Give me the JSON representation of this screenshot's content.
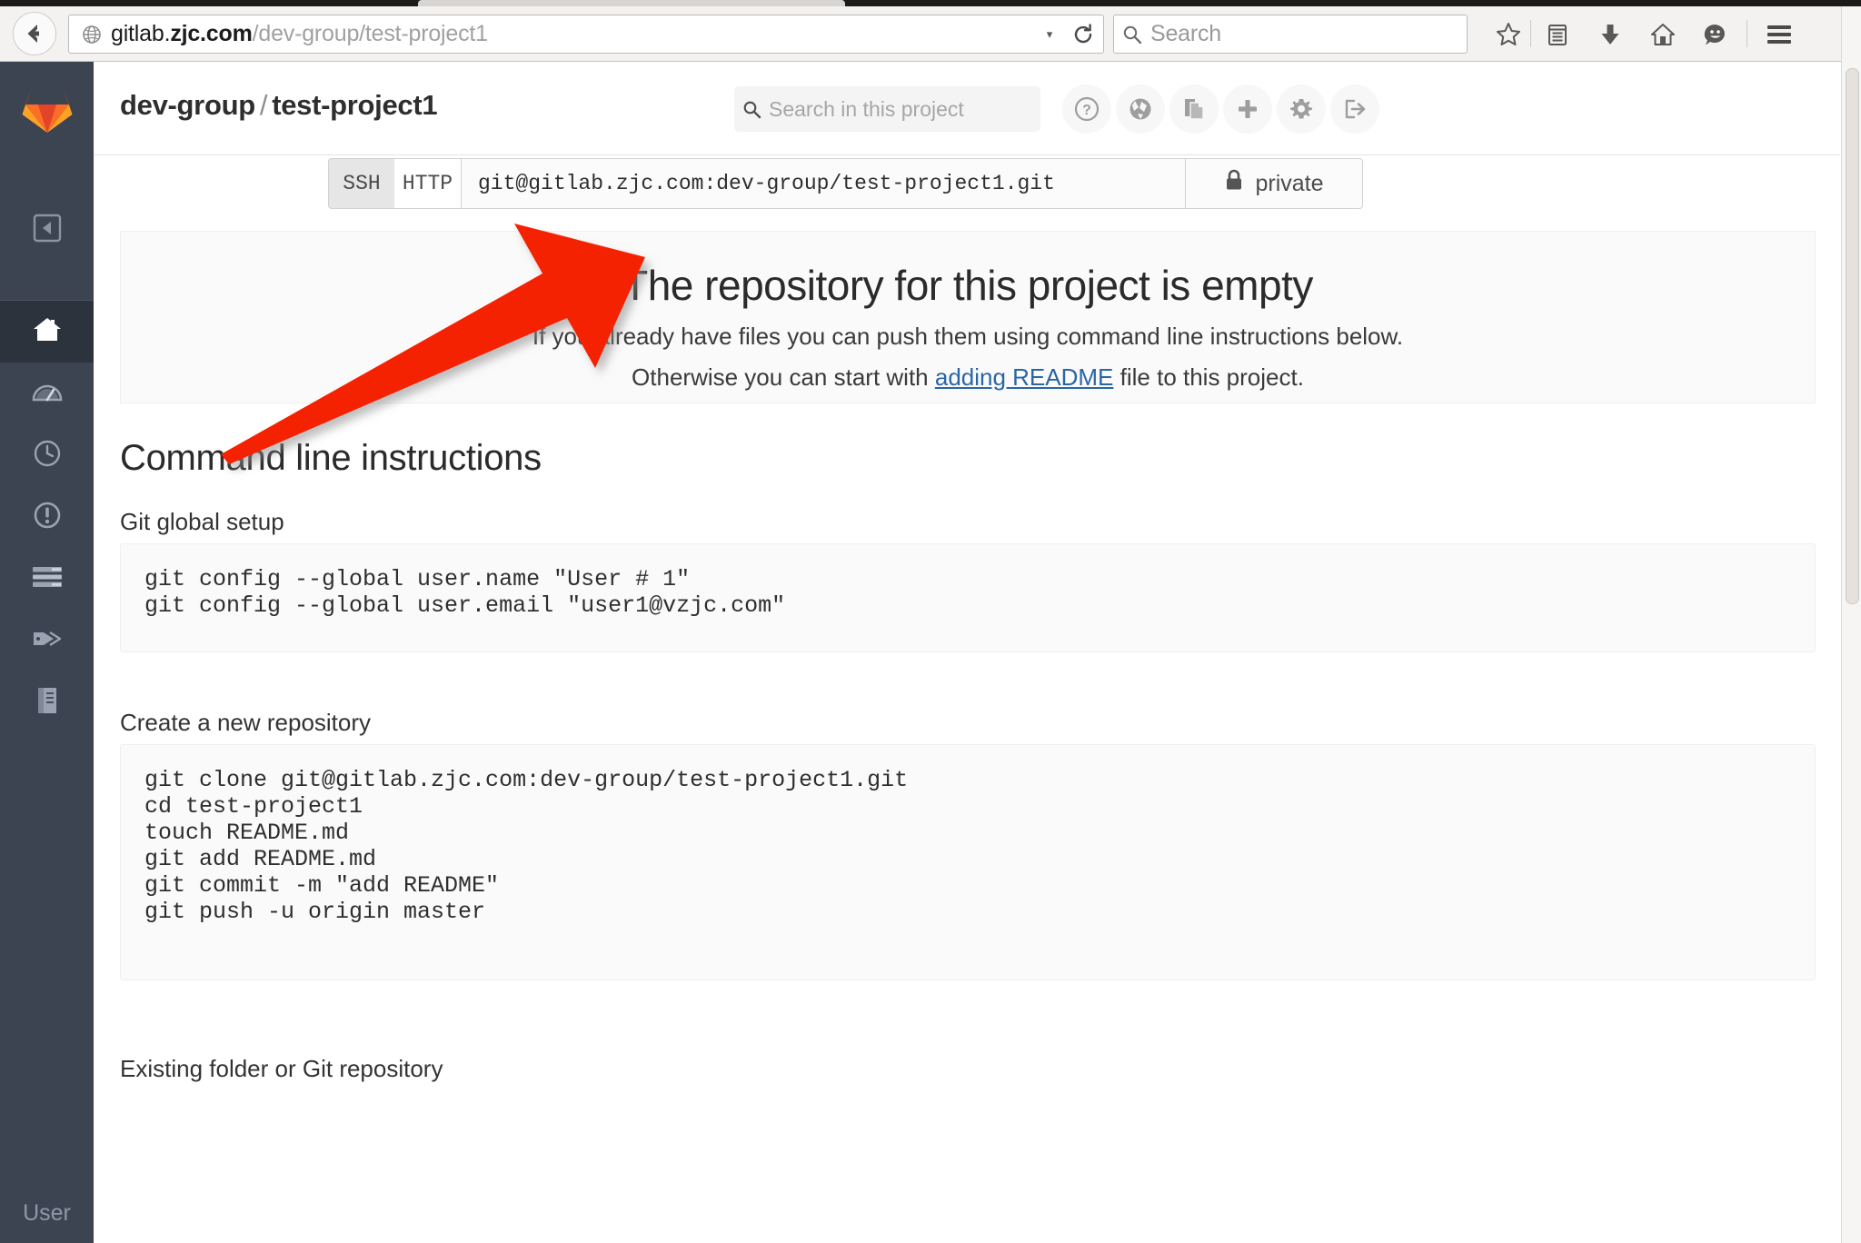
{
  "browser": {
    "back_button": "Back",
    "url_prefix": "gitlab.",
    "url_host_bold": "zjc.com",
    "url_path": "/dev-group/test-project1",
    "url_full": "gitlab.zjc.com/dev-group/test-project1",
    "search_placeholder": "Search",
    "toolbar_icons": [
      {
        "name": "bookmark-star-icon",
        "label": "Bookmark this page"
      },
      {
        "name": "library-icon",
        "label": "Show your library"
      },
      {
        "name": "downloads-icon",
        "label": "Downloads"
      },
      {
        "name": "home-icon",
        "label": "Home"
      },
      {
        "name": "pocket-icon",
        "label": "Save to Pocket"
      },
      {
        "name": "menu-hamburger-icon",
        "label": "Open menu"
      }
    ]
  },
  "sidebar": {
    "logo_label": "GitLab",
    "collapse_label": "Collapse sidebar",
    "user_label": "User",
    "items": [
      {
        "name": "sidebar-item-project-home",
        "label": "Project",
        "icon": "home-icon",
        "active": true
      },
      {
        "name": "sidebar-item-activity",
        "label": "Activity",
        "icon": "dashboard-icon",
        "active": false
      },
      {
        "name": "sidebar-item-cycle-analytics",
        "label": "Cycle Analytics",
        "icon": "clock-icon",
        "active": false
      },
      {
        "name": "sidebar-item-issues",
        "label": "Issues",
        "icon": "exclamation-circle-icon",
        "active": false
      },
      {
        "name": "sidebar-item-merge-requests",
        "label": "Merge Requests",
        "icon": "list-lines-icon",
        "active": false
      },
      {
        "name": "sidebar-item-labels",
        "label": "Labels",
        "icon": "tag-icon",
        "active": false
      },
      {
        "name": "sidebar-item-wiki",
        "label": "Wiki",
        "icon": "book-icon",
        "active": false
      }
    ]
  },
  "header": {
    "group": "dev-group",
    "separator": "/",
    "project": "test-project1",
    "search_placeholder": "Search in this project",
    "icons": [
      {
        "name": "help-icon",
        "label": "Help"
      },
      {
        "name": "globe-icon",
        "label": "Public projects"
      },
      {
        "name": "files-icon",
        "label": "Snippets"
      },
      {
        "name": "plus-icon",
        "label": "New"
      },
      {
        "name": "gear-icon",
        "label": "Settings"
      },
      {
        "name": "sign-out-icon",
        "label": "Sign out"
      }
    ]
  },
  "clone": {
    "ssh_tab": "SSH",
    "http_tab": "HTTP",
    "active_tab": "SSH",
    "url": "git@gitlab.zjc.com:dev-group/test-project1.git",
    "visibility": "private"
  },
  "empty_repo": {
    "title": "The repository for this project is empty",
    "line1": "If you already have files you can push them using command line instructions below.",
    "line2_before": "Otherwise you can start with ",
    "line2_link": "adding README",
    "line2_after": " file to this project."
  },
  "cli": {
    "heading": "Command line instructions",
    "sections": [
      {
        "title": "Git global setup",
        "code": "git config --global user.name \"User # 1\"\ngit config --global user.email \"user1@vzjc.com\""
      },
      {
        "title": "Create a new repository",
        "code": "git clone git@gitlab.zjc.com:dev-group/test-project1.git\ncd test-project1\ntouch README.md\ngit add README.md\ngit commit -m \"add README\"\ngit push -u origin master"
      },
      {
        "title": "Existing folder or Git repository",
        "code": ""
      }
    ]
  },
  "annotation": {
    "arrow_color": "#f42000",
    "arrow_label": "red-pointer-arrow pointing at HTTP tab"
  },
  "colors": {
    "sidebar_bg": "#3c4451",
    "sidebar_active": "#2d333d",
    "link_blue": "#2a66a5",
    "code_bg": "#fafafa",
    "gitlab_orange": "#fc6d26",
    "gitlab_red": "#e24329"
  }
}
